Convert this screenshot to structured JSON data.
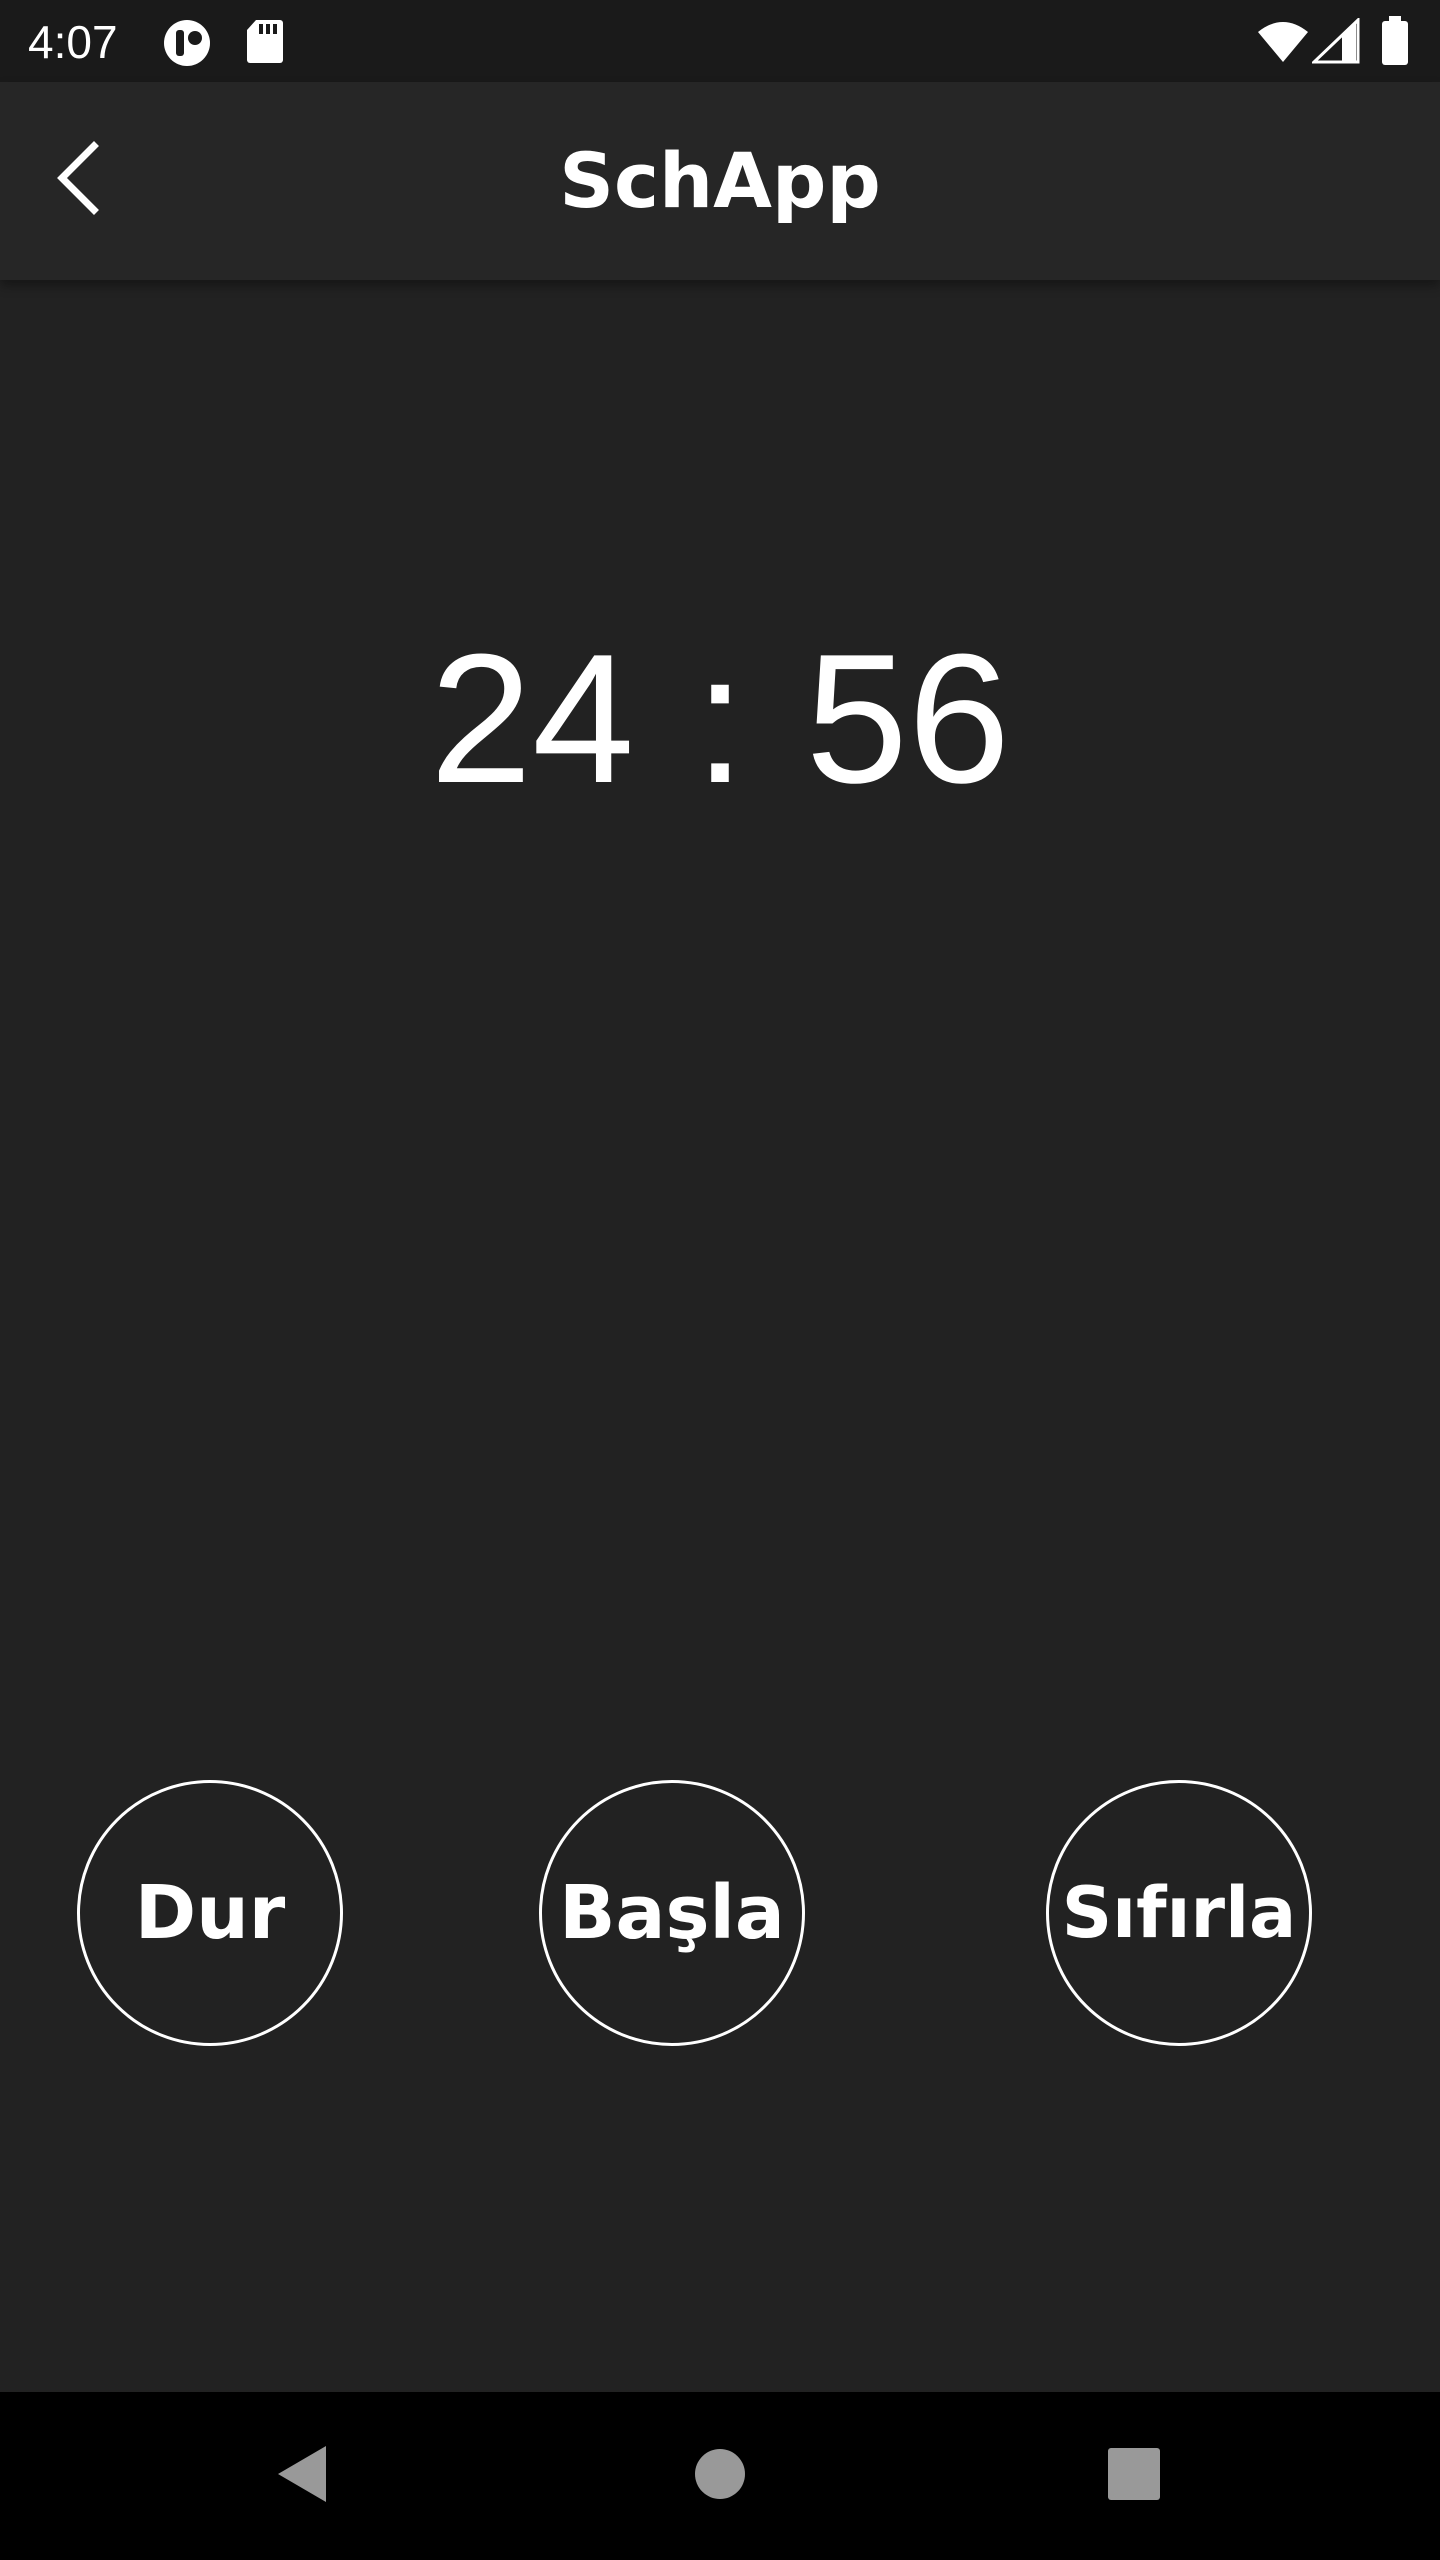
{
  "status_bar": {
    "time": "4:07",
    "icons": [
      "data-saver-icon",
      "sd-card-icon",
      "wifi-icon",
      "signal-icon",
      "battery-icon"
    ]
  },
  "app_bar": {
    "title": "SchApp",
    "back_icon": "chevron-left-icon"
  },
  "timer": {
    "minutes": "24",
    "separator": ":",
    "seconds": "56"
  },
  "controls": {
    "stop_label": "Dur",
    "start_label": "Başla",
    "reset_label": "Sıfırla"
  },
  "nav_bar": {
    "icons": [
      "back-triangle-icon",
      "home-circle-icon",
      "recents-square-icon"
    ]
  },
  "colors": {
    "background": "#222222",
    "app_bar": "#262626",
    "status_bar": "#1a1a1a",
    "nav_bar": "#000000",
    "foreground": "#ffffff"
  }
}
